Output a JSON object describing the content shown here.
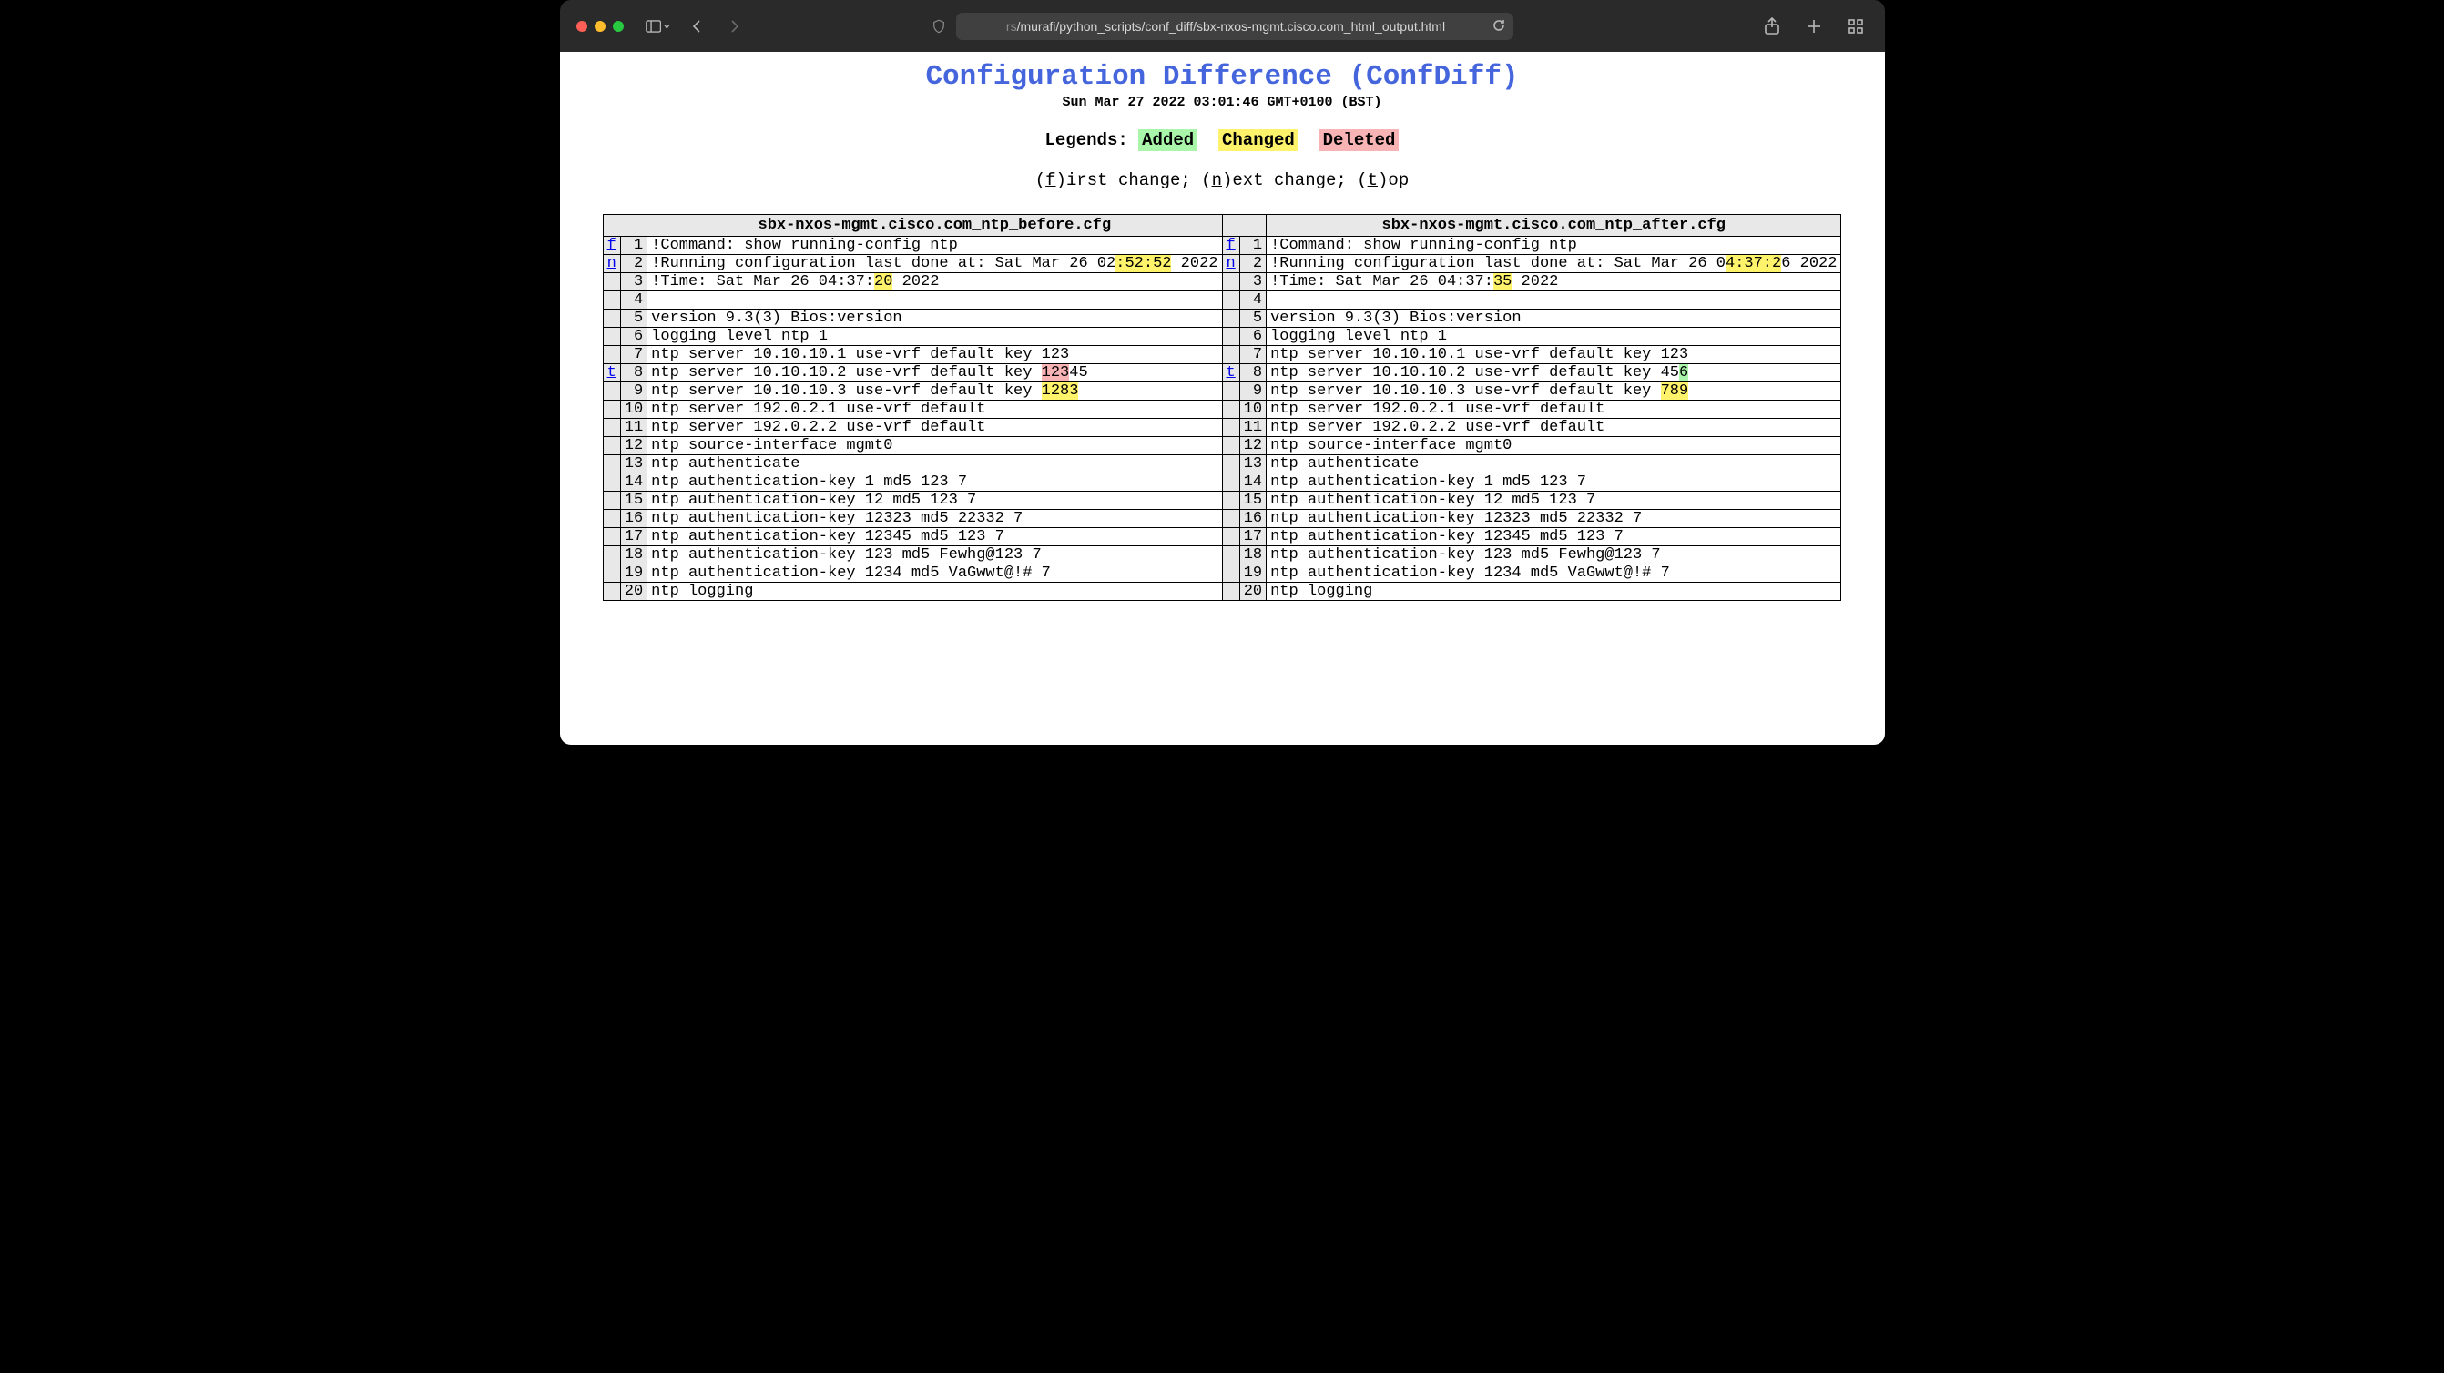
{
  "browser": {
    "url_faded_prefix": "rs",
    "url": "/murafi/python_scripts/conf_diff/sbx-nxos-mgmt.cisco.com_html_output.html"
  },
  "header": {
    "title": "Configuration Difference (ConfDiff)",
    "timestamp": "Sun Mar 27 2022 03:01:46 GMT+0100 (BST)",
    "legends_label": "Legends: ",
    "legend_added": "Added",
    "legend_changed": "Changed",
    "legend_deleted": "Deleted",
    "nav_first_u": "f",
    "nav_first_rest": ")irst change; (",
    "nav_next_u": "n",
    "nav_next_rest": ")ext change; (",
    "nav_top_u": "t",
    "nav_top_rest": ")op"
  },
  "files": {
    "left": "sbx-nxos-mgmt.cisco.com_ntp_before.cfg",
    "right": "sbx-nxos-mgmt.cisco.com_ntp_after.cfg"
  },
  "rows": [
    {
      "llink": "f",
      "lnum": "1",
      "l": [
        [
          "",
          "!Command: show running-config ntp"
        ]
      ],
      "rlink": "f",
      "rnum": "1",
      "r": [
        [
          "",
          "!Command: show running-config ntp"
        ]
      ]
    },
    {
      "llink": "n",
      "lnum": "2",
      "l": [
        [
          "",
          "!Running configuration last done at: Sat Mar 26 02"
        ],
        [
          "chg",
          ":52:52"
        ],
        [
          "",
          " 2022"
        ]
      ],
      "rlink": "n",
      "rnum": "2",
      "r": [
        [
          "",
          "!Running configuration last done at: Sat Mar 26 0"
        ],
        [
          "chg",
          "4:37:2"
        ],
        [
          "",
          "6 2022"
        ]
      ]
    },
    {
      "llink": "",
      "lnum": "3",
      "l": [
        [
          "",
          "!Time: Sat Mar 26 04:37:"
        ],
        [
          "chg",
          "20"
        ],
        [
          "",
          " 2022"
        ]
      ],
      "rlink": "",
      "rnum": "3",
      "r": [
        [
          "",
          "!Time: Sat Mar 26 04:37:"
        ],
        [
          "chg",
          "35"
        ],
        [
          "",
          " 2022"
        ]
      ]
    },
    {
      "llink": "",
      "lnum": "4",
      "l": [
        [
          "",
          ""
        ]
      ],
      "rlink": "",
      "rnum": "4",
      "r": [
        [
          "",
          ""
        ]
      ]
    },
    {
      "llink": "",
      "lnum": "5",
      "l": [
        [
          "",
          "version 9.3(3) Bios:version"
        ]
      ],
      "rlink": "",
      "rnum": "5",
      "r": [
        [
          "",
          "version 9.3(3) Bios:version"
        ]
      ]
    },
    {
      "llink": "",
      "lnum": "6",
      "l": [
        [
          "",
          "logging level ntp 1"
        ]
      ],
      "rlink": "",
      "rnum": "6",
      "r": [
        [
          "",
          "logging level ntp 1"
        ]
      ]
    },
    {
      "llink": "",
      "lnum": "7",
      "l": [
        [
          "",
          "ntp server 10.10.10.1 use-vrf default key 123"
        ]
      ],
      "rlink": "",
      "rnum": "7",
      "r": [
        [
          "",
          "ntp server 10.10.10.1 use-vrf default key 123"
        ]
      ]
    },
    {
      "llink": "t",
      "lnum": "8",
      "l": [
        [
          "",
          "ntp server 10.10.10.2 use-vrf default key "
        ],
        [
          "del",
          "123"
        ],
        [
          "",
          "45"
        ]
      ],
      "rlink": "t",
      "rnum": "8",
      "r": [
        [
          "",
          "ntp server 10.10.10.2 use-vrf default key 45"
        ],
        [
          "add",
          "6"
        ]
      ]
    },
    {
      "llink": "",
      "lnum": "9",
      "l": [
        [
          "",
          "ntp server 10.10.10.3 use-vrf default key "
        ],
        [
          "chg",
          "1283"
        ]
      ],
      "rlink": "",
      "rnum": "9",
      "r": [
        [
          "",
          "ntp server 10.10.10.3 use-vrf default key "
        ],
        [
          "chg",
          "789"
        ]
      ]
    },
    {
      "llink": "",
      "lnum": "10",
      "l": [
        [
          "",
          "ntp server 192.0.2.1 use-vrf default"
        ]
      ],
      "rlink": "",
      "rnum": "10",
      "r": [
        [
          "",
          "ntp server 192.0.2.1 use-vrf default"
        ]
      ]
    },
    {
      "llink": "",
      "lnum": "11",
      "l": [
        [
          "",
          "ntp server 192.0.2.2 use-vrf default"
        ]
      ],
      "rlink": "",
      "rnum": "11",
      "r": [
        [
          "",
          "ntp server 192.0.2.2 use-vrf default"
        ]
      ]
    },
    {
      "llink": "",
      "lnum": "12",
      "l": [
        [
          "",
          "ntp source-interface mgmt0"
        ]
      ],
      "rlink": "",
      "rnum": "12",
      "r": [
        [
          "",
          "ntp source-interface mgmt0"
        ]
      ]
    },
    {
      "llink": "",
      "lnum": "13",
      "l": [
        [
          "",
          "ntp authenticate"
        ]
      ],
      "rlink": "",
      "rnum": "13",
      "r": [
        [
          "",
          "ntp authenticate"
        ]
      ]
    },
    {
      "llink": "",
      "lnum": "14",
      "l": [
        [
          "",
          "ntp authentication-key 1 md5 123 7"
        ]
      ],
      "rlink": "",
      "rnum": "14",
      "r": [
        [
          "",
          "ntp authentication-key 1 md5 123 7"
        ]
      ]
    },
    {
      "llink": "",
      "lnum": "15",
      "l": [
        [
          "",
          "ntp authentication-key 12 md5 123 7"
        ]
      ],
      "rlink": "",
      "rnum": "15",
      "r": [
        [
          "",
          "ntp authentication-key 12 md5 123 7"
        ]
      ]
    },
    {
      "llink": "",
      "lnum": "16",
      "l": [
        [
          "",
          "ntp authentication-key 12323 md5 22332 7"
        ]
      ],
      "rlink": "",
      "rnum": "16",
      "r": [
        [
          "",
          "ntp authentication-key 12323 md5 22332 7"
        ]
      ]
    },
    {
      "llink": "",
      "lnum": "17",
      "l": [
        [
          "",
          "ntp authentication-key 12345 md5 123 7"
        ]
      ],
      "rlink": "",
      "rnum": "17",
      "r": [
        [
          "",
          "ntp authentication-key 12345 md5 123 7"
        ]
      ]
    },
    {
      "llink": "",
      "lnum": "18",
      "l": [
        [
          "",
          "ntp authentication-key 123 md5 Fewhg@123 7"
        ]
      ],
      "rlink": "",
      "rnum": "18",
      "r": [
        [
          "",
          "ntp authentication-key 123 md5 Fewhg@123 7"
        ]
      ]
    },
    {
      "llink": "",
      "lnum": "19",
      "l": [
        [
          "",
          "ntp authentication-key 1234 md5 VaGwwt@!# 7"
        ]
      ],
      "rlink": "",
      "rnum": "19",
      "r": [
        [
          "",
          "ntp authentication-key 1234 md5 VaGwwt@!# 7"
        ]
      ]
    },
    {
      "llink": "",
      "lnum": "20",
      "l": [
        [
          "",
          "ntp logging"
        ]
      ],
      "rlink": "",
      "rnum": "20",
      "r": [
        [
          "",
          "ntp logging"
        ]
      ]
    }
  ]
}
